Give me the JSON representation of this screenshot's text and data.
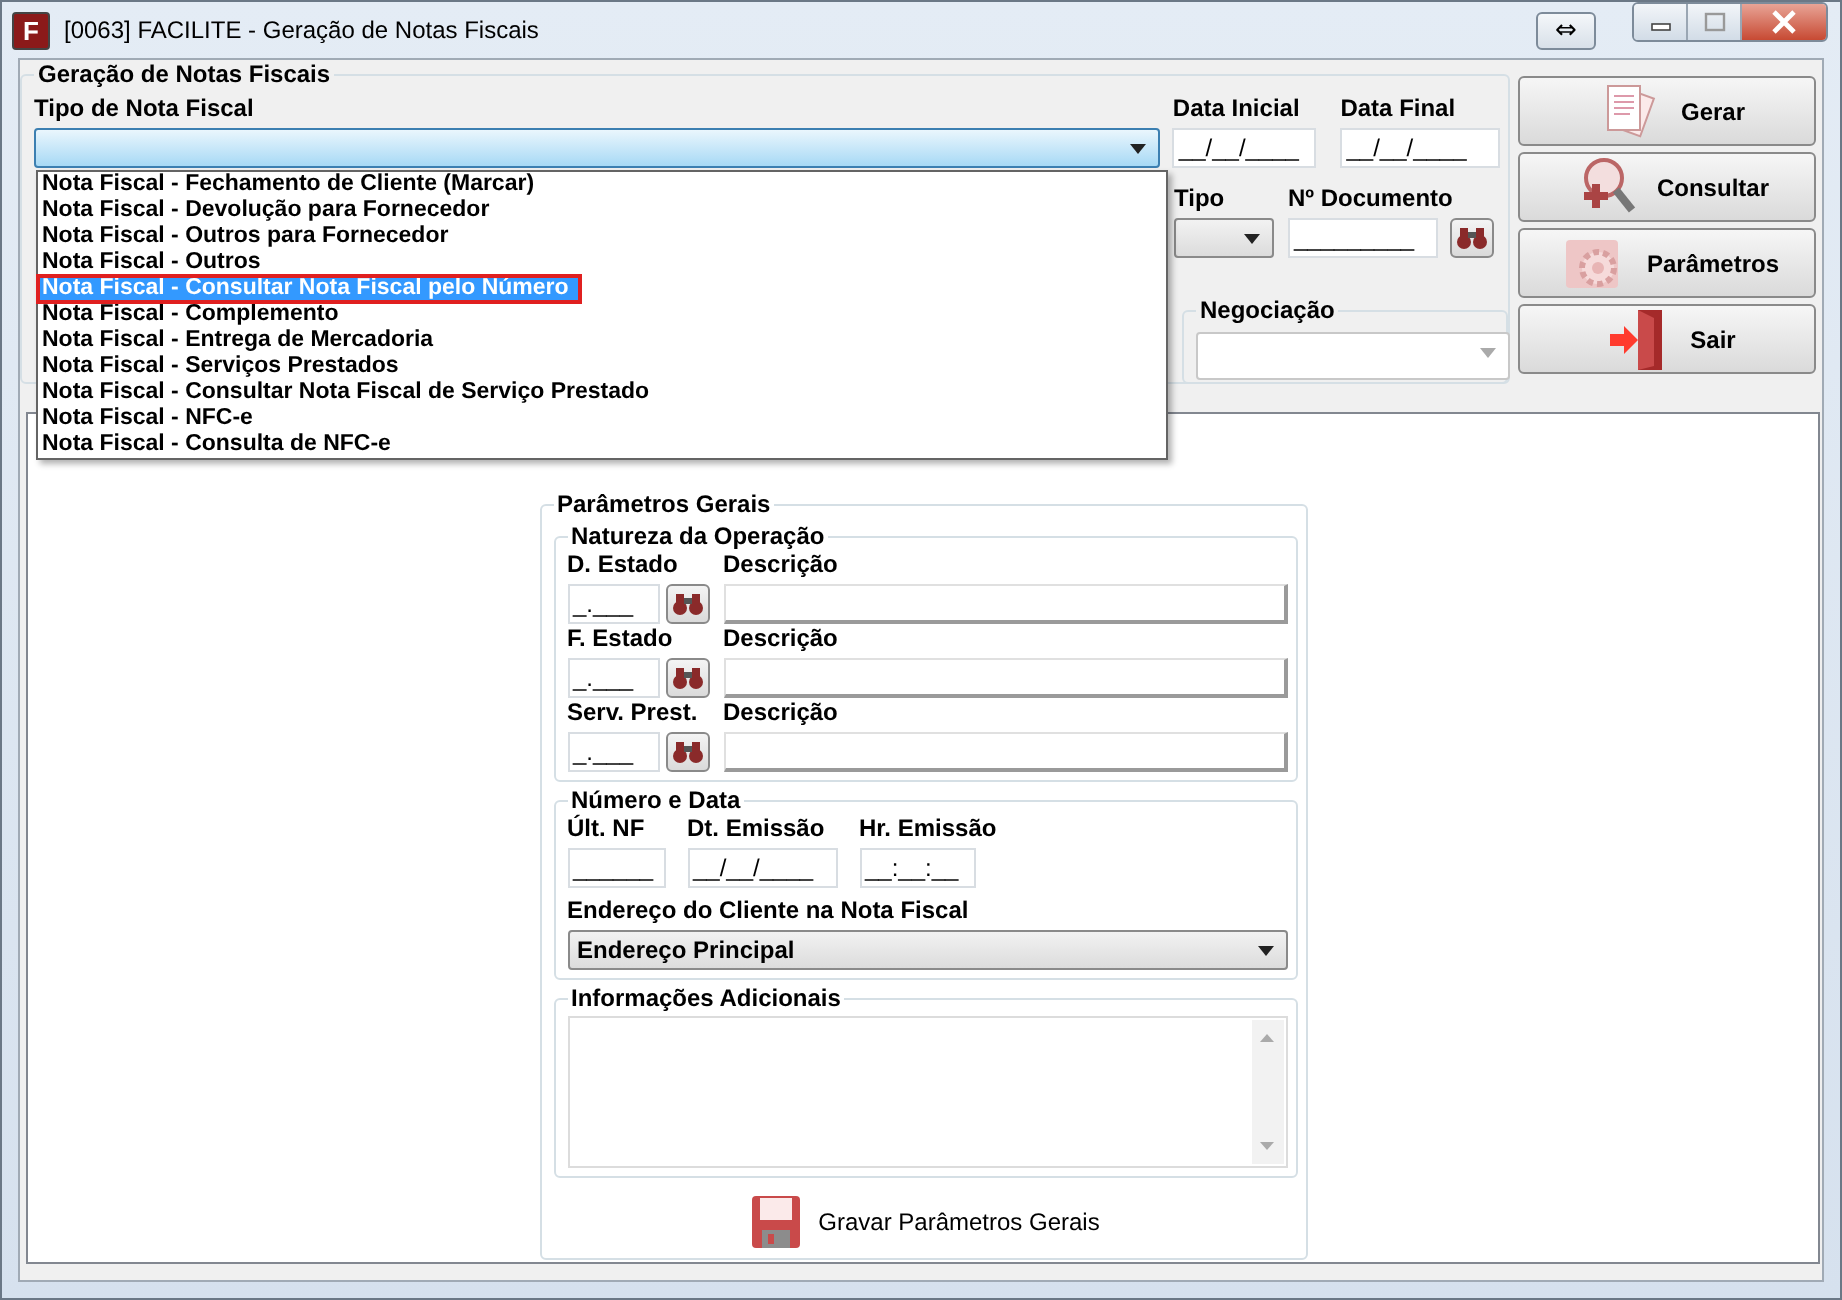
{
  "window": {
    "logo_letter": "F",
    "title": "[0063] FACILITE - Geração de Notas Fiscais",
    "swap_button": "⇔"
  },
  "main_group": {
    "title": "Geração de Notas Fiscais",
    "tipo_nota": {
      "label": "Tipo de Nota Fiscal",
      "expanded": true,
      "options": [
        {
          "label": "Nota Fiscal - Fechamento de Cliente (Marcar)",
          "selected": false
        },
        {
          "label": "Nota Fiscal - Devolução para Fornecedor",
          "selected": false
        },
        {
          "label": "Nota Fiscal - Outros para Fornecedor",
          "selected": false
        },
        {
          "label": "Nota Fiscal - Outros",
          "selected": false
        },
        {
          "label": "Nota Fiscal - Consultar Nota Fiscal pelo Número",
          "selected": true
        },
        {
          "label": "Nota Fiscal - Complemento",
          "selected": false
        },
        {
          "label": "Nota Fiscal - Entrega de Mercadoria",
          "selected": false
        },
        {
          "label": "Nota Fiscal - Serviços Prestados",
          "selected": false
        },
        {
          "label": "Nota Fiscal - Consultar Nota Fiscal de Serviço Prestado",
          "selected": false
        },
        {
          "label": "Nota Fiscal - NFC-e",
          "selected": false
        },
        {
          "label": "Nota Fiscal - Consulta de NFC-e",
          "selected": false
        }
      ]
    },
    "data_inicial": {
      "label": "Data Inicial",
      "value": "__/__/____"
    },
    "data_final": {
      "label": "Data Final",
      "value": "__/__/____"
    },
    "tipo": {
      "label": "Tipo"
    },
    "documento": {
      "label": "Nº Documento",
      "value": "_________"
    },
    "negociacao": {
      "label": "Negociação"
    }
  },
  "actions": [
    {
      "kind": "gerar",
      "label": "Gerar"
    },
    {
      "kind": "consultar",
      "label": "Consultar"
    },
    {
      "kind": "parametros",
      "label": "Parâmetros"
    },
    {
      "kind": "sair",
      "label": "Sair"
    }
  ],
  "parametros_gerais": {
    "title": "Parâmetros Gerais",
    "natureza": {
      "title": "Natureza da Operação",
      "rows": [
        {
          "label": "D. Estado",
          "value": "_.___",
          "description_label": "Descrição"
        },
        {
          "label": "F. Estado",
          "value": "_.___",
          "description_label": "Descrição"
        },
        {
          "label": "Serv. Prest.",
          "value": "_.___",
          "description_label": "Descrição"
        }
      ]
    },
    "numero_data": {
      "title": "Número e Data",
      "ult_nf": {
        "label": "Últ. NF",
        "value": "______"
      },
      "dt_emissao": {
        "label": "Dt. Emissão",
        "value": "__/__/____"
      },
      "hr_emissao": {
        "label": "Hr. Emissão",
        "value": "__:__:__"
      },
      "endereco": {
        "label": "Endereço do Cliente na Nota Fiscal",
        "value": "Endereço Principal"
      }
    },
    "info": {
      "title": "Informações Adicionais"
    },
    "save_button": "Gravar Parâmetros Gerais"
  }
}
